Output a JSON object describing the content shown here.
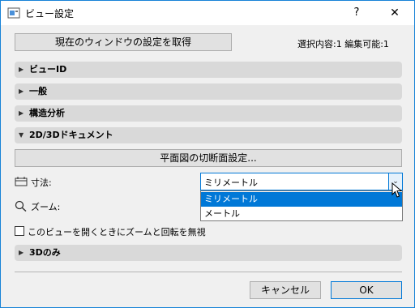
{
  "window": {
    "title": "ビュー設定",
    "help": "?",
    "close": "✕"
  },
  "toolbar": {
    "get_settings_label": "現在のウィンドウの設定を取得",
    "status": "選択内容:1 編集可能:1"
  },
  "sections": {
    "view_id": "ビューID",
    "general": "一般",
    "structural": "構造分析",
    "doc": "2D/3Dドキュメント",
    "only3d": "3Dのみ"
  },
  "doc": {
    "cut_plane_label": "平面図の切断面設定...",
    "dimension_label": "寸法:",
    "dimension_value": "ミリメートル",
    "dimension_options": [
      "ミリメートル",
      "メートル"
    ],
    "zoom_label": "ズーム:",
    "ignore_zoom_label": "このビューを開くときにズームと回転を無視"
  },
  "footer": {
    "cancel_label": "キャンセル",
    "ok_label": "OK"
  },
  "colors": {
    "accent": "#0078d7",
    "section_bg": "#d9d9d9",
    "dialog_bg": "#f0f0f0"
  }
}
